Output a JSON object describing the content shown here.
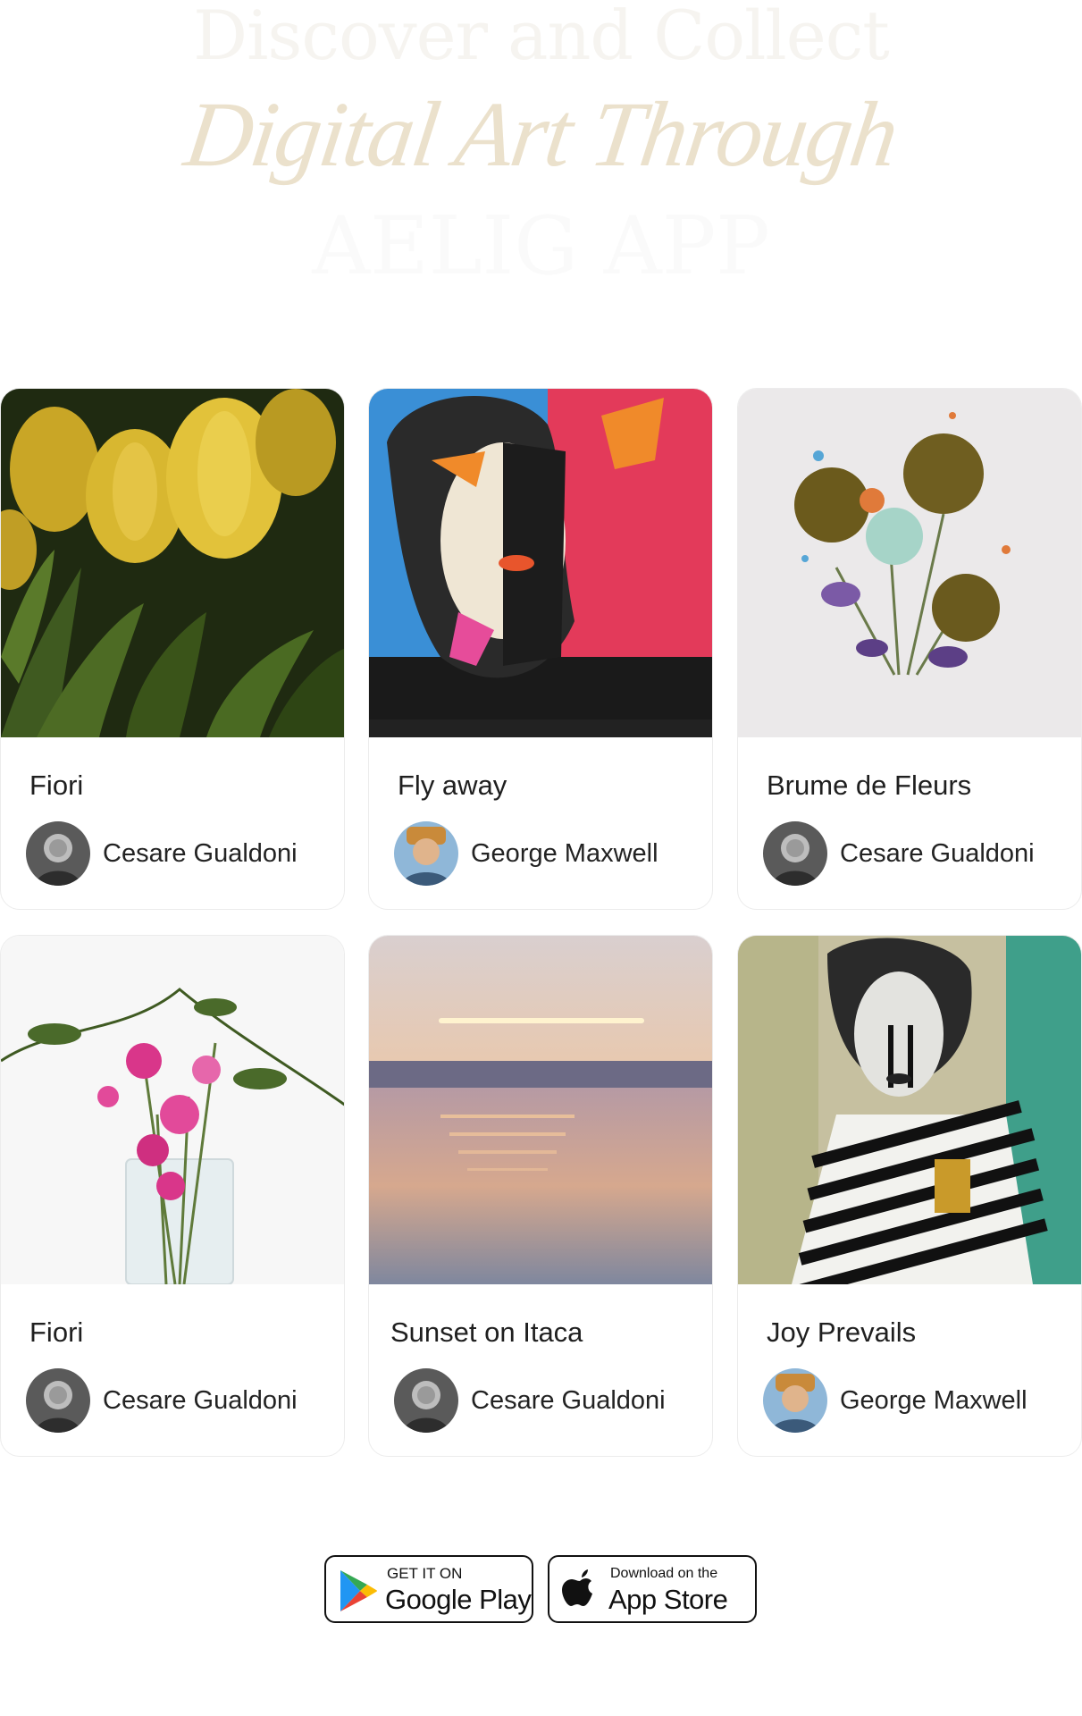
{
  "hero": {
    "line1": "Discover and Collect",
    "line2": "Digital Art Through",
    "line3": "AELIG APP"
  },
  "artworks": [
    {
      "title": "Fiori",
      "artist": "Cesare Gualdoni",
      "image": "yellow-tulips"
    },
    {
      "title": "Fly away",
      "artist": "George Maxwell",
      "image": "woman-butterflies"
    },
    {
      "title": "Brume de Fleurs",
      "artist": "Cesare Gualdoni",
      "image": "watercolor-flowers"
    },
    {
      "title": "Fiori",
      "artist": "Cesare Gualdoni",
      "image": "pink-orchids-vase"
    },
    {
      "title": "Sunset on Itaca",
      "artist": "Cesare Gualdoni",
      "image": "sunset-lake"
    },
    {
      "title": "Joy Prevails",
      "artist": "George Maxwell",
      "image": "striped-pierrot"
    }
  ],
  "stores": {
    "google": {
      "small": "GET IT ON",
      "big": "Google Play",
      "icon": "google-play-icon"
    },
    "apple": {
      "small": "Download on the",
      "big": "App Store",
      "icon": "apple-icon"
    }
  },
  "colors": {
    "hero_script": "#ebe1cc",
    "hero_faint": "#f6f4f0",
    "card_border": "#ececec",
    "button_border": "#111111"
  }
}
